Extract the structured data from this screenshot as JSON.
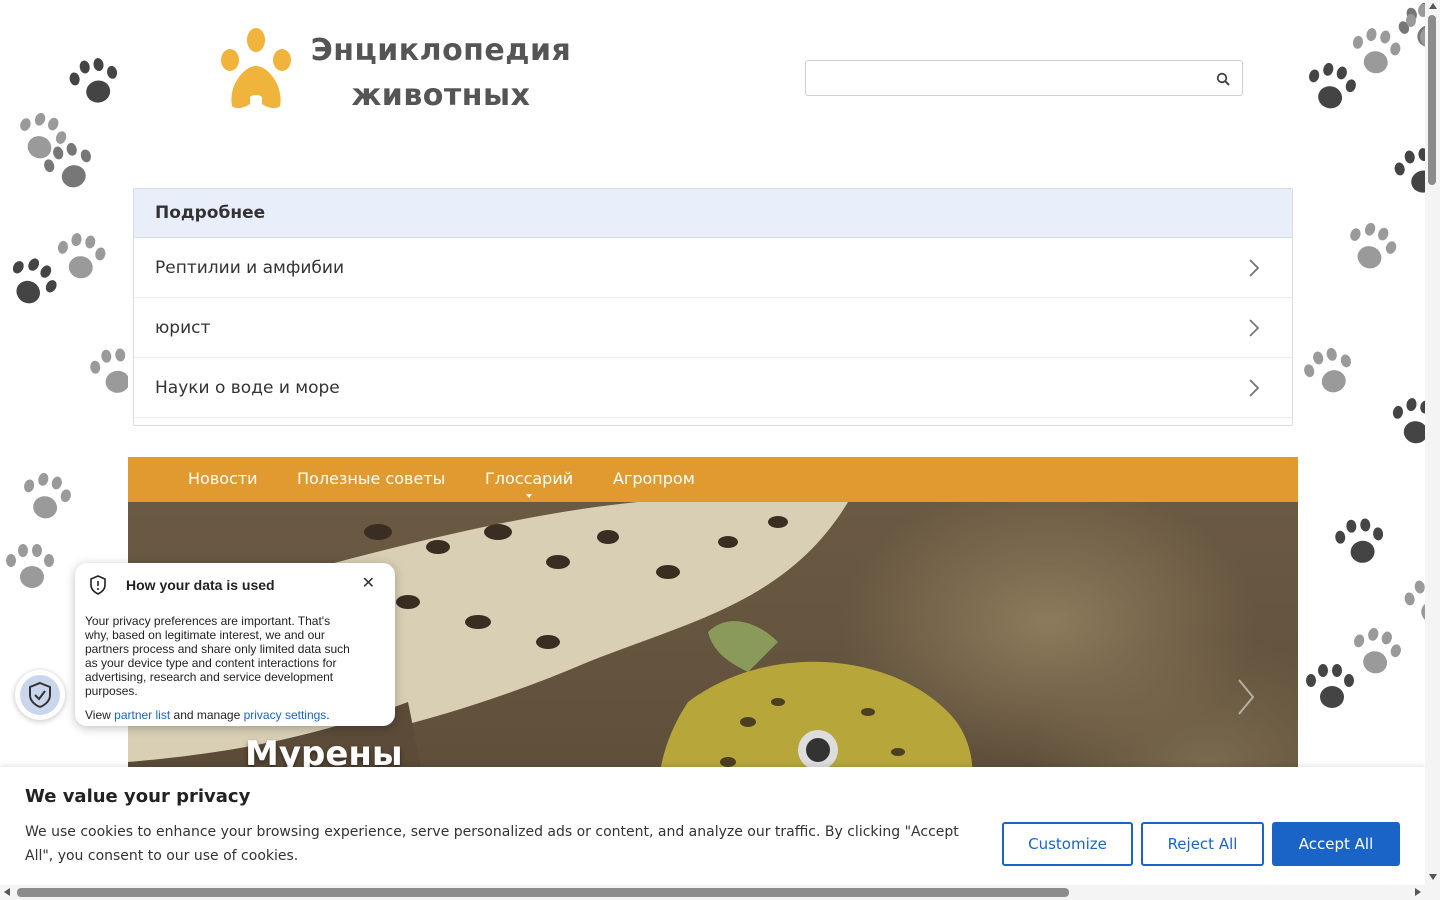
{
  "header": {
    "logo_line1": "Энциклопедия",
    "logo_line2": "животных",
    "search_placeholder": "",
    "accent_color": "#f0b33c"
  },
  "more": {
    "title": "Подробнее",
    "items": [
      {
        "label": "Рептилии и амфибии"
      },
      {
        "label": "юрист"
      },
      {
        "label": "Науки о воде и море"
      }
    ]
  },
  "nav": {
    "color": "#e09a30",
    "items": [
      {
        "label": "Новости"
      },
      {
        "label": "Полезные советы"
      },
      {
        "label": "Глоссарий"
      },
      {
        "label": "Агропром"
      }
    ]
  },
  "hero": {
    "title": "Мурены"
  },
  "data_popover": {
    "title": "How your data is used",
    "body": "Your privacy preferences are important. That's why, based on legitimate interest, we and our partners process and share only limited data such as your device type and content interactions for advertising, research and service development purposes.",
    "view": "View",
    "partner_link": "partner list",
    "and_manage": "and manage",
    "privacy_link": "privacy settings",
    "period": "."
  },
  "cookie": {
    "title": "We value your privacy",
    "text": "We use cookies to enhance your browsing experience, serve personalized ads or content, and analyze our traffic. By clicking \"Accept All\", you consent to our use of cookies.",
    "customize": "Customize",
    "reject": "Reject All",
    "accept": "Accept All",
    "button_color": "#1a64c8"
  },
  "icons": {
    "search": "search-icon",
    "chevron": "chevron-right-icon",
    "shield": "shield-check-icon",
    "close": "close-icon"
  }
}
